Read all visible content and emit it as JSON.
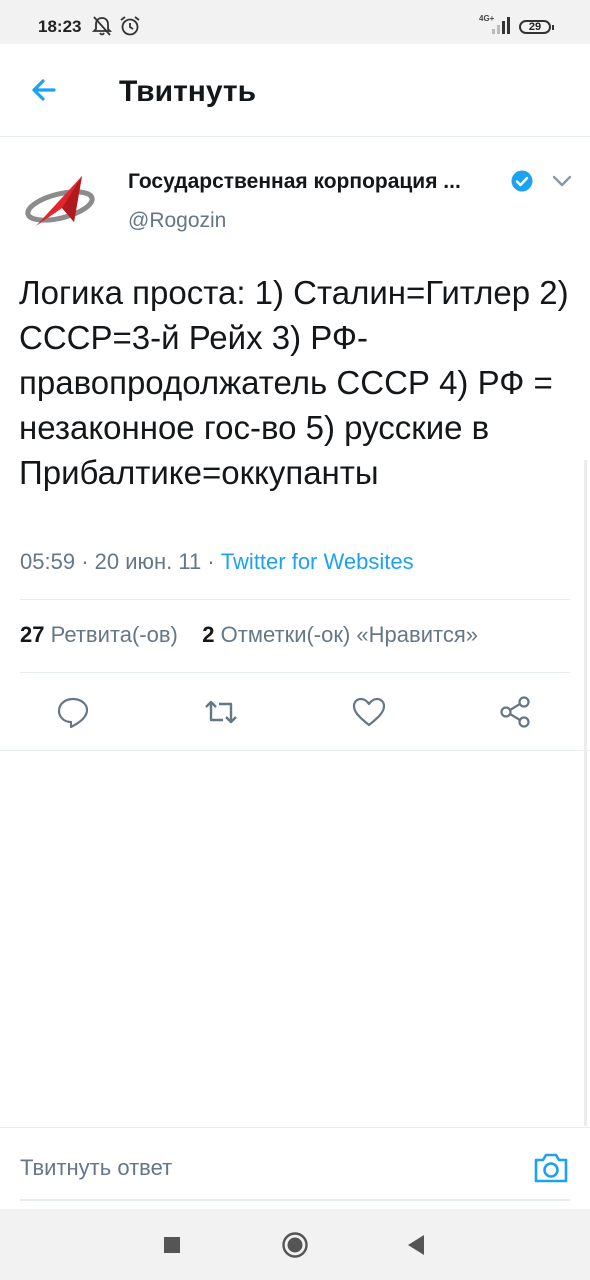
{
  "status_bar": {
    "time": "18:23",
    "network": "4G+",
    "battery": "29",
    "icons": [
      "notifications-off-icon",
      "alarm-icon",
      "signal-icon",
      "battery-icon"
    ]
  },
  "app_bar": {
    "title": "Твитнуть",
    "back_icon": "back-arrow-icon"
  },
  "tweet": {
    "author_name": "Государственная корпорация ...",
    "handle": "@Rogozin",
    "verified": true,
    "text": "Логика проста: 1) Сталин=Гитлер 2) СССР=3-й Рейх 3) РФ-правопродолжатель СССР 4) РФ = незаконное гос-во 5) русские в Прибалтике=оккупанты",
    "time": "05:59",
    "date": "20 июн. 11",
    "separator": "·",
    "source": "Twitter for Websites"
  },
  "stats": {
    "retweets_count": "27",
    "retweets_label": "Ретвита(-ов)",
    "likes_count": "2",
    "likes_label": "Отметки(-ок) «Нравится»"
  },
  "actions": [
    "reply-icon",
    "retweet-icon",
    "like-icon",
    "share-icon"
  ],
  "reply_bar": {
    "placeholder": "Твитнуть ответ",
    "camera_icon": "camera-icon"
  },
  "nav_bar": [
    "recents-square-icon",
    "home-circle-icon",
    "back-triangle-icon"
  ],
  "colors": {
    "accent": "#1da1f2",
    "text": "#14171a",
    "secondary": "#657786",
    "divider": "#e6ecf0",
    "logo_red": "#e3262b",
    "logo_grey": "#8c8c8c"
  }
}
